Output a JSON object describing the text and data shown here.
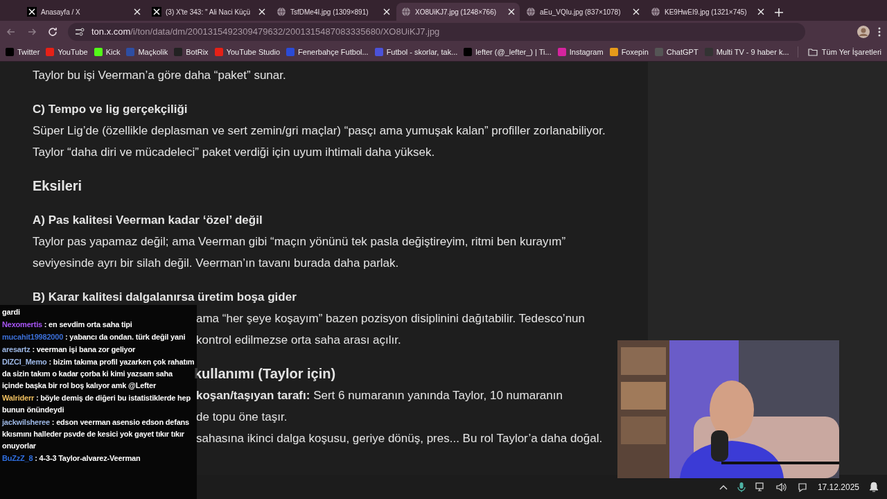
{
  "tabs": [
    {
      "title": "Anasayfa / X",
      "kind": "x",
      "selected": false
    },
    {
      "title": "(3) X'te 343: \" Ali Naci Küçü",
      "kind": "x",
      "selected": false
    },
    {
      "title": "TsfDMe4I.jpg (1309×891)",
      "kind": "page",
      "selected": false
    },
    {
      "title": "XO8UiKJ7.jpg (1248×766)",
      "kind": "page",
      "selected": true
    },
    {
      "title": "aEu_VQIu.jpg (837×1078)",
      "kind": "page",
      "selected": false
    },
    {
      "title": "KE9HwEI9.jpg (1321×745)",
      "kind": "page",
      "selected": false
    }
  ],
  "address": {
    "host": "ton.x.com",
    "path": "/i/ton/data/dm/2001315492309479632/2001315487083335680/XO8UiKJ7.jpg"
  },
  "bookmarks": [
    {
      "label": "Twitter",
      "color": "#000000"
    },
    {
      "label": "YouTube",
      "color": "#e62117"
    },
    {
      "label": "Kick",
      "color": "#53fc18"
    },
    {
      "label": "Maçkolik",
      "color": "#2e4ea3"
    },
    {
      "label": "BotRix",
      "color": "#222222"
    },
    {
      "label": "YouTube Studio",
      "color": "#e62117"
    },
    {
      "label": "Fenerbahçe Futbol...",
      "color": "#2b4bd6"
    },
    {
      "label": "Futbol - skorlar, tak...",
      "color": "#4b52d9"
    },
    {
      "label": "lefter (@_lefter_) | Ti...",
      "color": "#000000"
    },
    {
      "label": "Instagram",
      "color": "#d6249f"
    },
    {
      "label": "Foxepin",
      "color": "#e69a1a"
    },
    {
      "label": "ChatGPT",
      "color": "#555555"
    },
    {
      "label": "Multi TV - 9 haber k...",
      "color": "#333333"
    }
  ],
  "all_bookmarks": "Tüm Yer İşaretleri",
  "document": [
    {
      "kind": "body",
      "text": "Taylor bu işi Veerman’a göre daha “paket” sunar."
    },
    {
      "kind": "subheading",
      "text": "C) Tempo ve lig gerçekçiliği"
    },
    {
      "kind": "body",
      "text": "Süper Lig’de (özellikle deplasman ve sert zemin/gri maçlar) “pasçı ama yumuşak kalan” profiller zorlanabiliyor."
    },
    {
      "kind": "body",
      "text": "Taylor “daha diri ve mücadeleci” paket verdiği için uyum ihtimali daha yüksek."
    },
    {
      "kind": "heading",
      "text": "Eksileri"
    },
    {
      "kind": "subheading",
      "text": "A) Pas kalitesi Veerman kadar ‘özel’ değil"
    },
    {
      "kind": "body",
      "text": "Taylor pas yapamaz değil; ama Veerman gibi “maçın yönünü tek pasla değiştireyim, ritmi ben kurayım”"
    },
    {
      "kind": "body",
      "text": "seviyesinde ayrı bir silah değil. Veerman’ın tavanı burada daha parlak."
    },
    {
      "kind": "subheading",
      "text": "B) Karar kalitesi dalgalanırsa üretim boşa gider"
    },
    {
      "kind": "partial",
      "text": "ama “her şeye koşayım” bazen pozisyon disiplinini dağıtabilir. Tedesco’nun"
    },
    {
      "kind": "partial",
      "text": "kontrol edilmezse orta saha arası açılır."
    },
    {
      "kind": "partial_heading",
      "text": "kullanımı (Taylor için)"
    },
    {
      "kind": "partial",
      "text": "**koşan/taşıyan tarafı:** Sert 6 numaranın yanında Taylor, 10 numaranın"
    },
    {
      "kind": "partial",
      "text": "de topu öne taşır."
    },
    {
      "kind": "partial",
      "text": "sahasına ikinci dalga koşusu, geriye dönüş, pres... Bu rol Taylor’a daha doğal."
    }
  ],
  "chat": [
    {
      "text": "gardi"
    },
    {
      "user": "Nexomertis",
      "color": "#a855f7",
      "text": ": en sevdim orta saha tipi"
    },
    {
      "user": "mucahit19982000",
      "color": "#3b6fd8",
      "text": ": yabancı da ondan. türk değil yani"
    },
    {
      "user": "aresartz",
      "color": "#9db8e6",
      "text": ": veerman işi bana zor geliyor"
    },
    {
      "user": "DIZCI_Memo",
      "color": "#9db8e6",
      "text": ": bizim takıma profil yazarken çok rahatım da sizin takım o kadar çorba ki kimi yazsam saha içinde başka bir rol boş kalıyor amk @Lefter"
    },
    {
      "user": "Walriderr",
      "color": "#f0c060",
      "text": ": böyle demiş de diğeri bu istatistiklerde hep bunun önündeydi"
    },
    {
      "user": "jackwilsheree",
      "color": "#9db8e6",
      "text": ": edson veerman asensio edson defans kkısmını halleder psvde de kesici yok gayet tıkır tıkır onuyorlar"
    },
    {
      "user": "BuZzZ_8",
      "color": "#2f6fe0",
      "text": ": 4-3-3 Taylor-alvarez-Veerman"
    }
  ],
  "taskbar": {
    "date": "17.12.2025"
  }
}
